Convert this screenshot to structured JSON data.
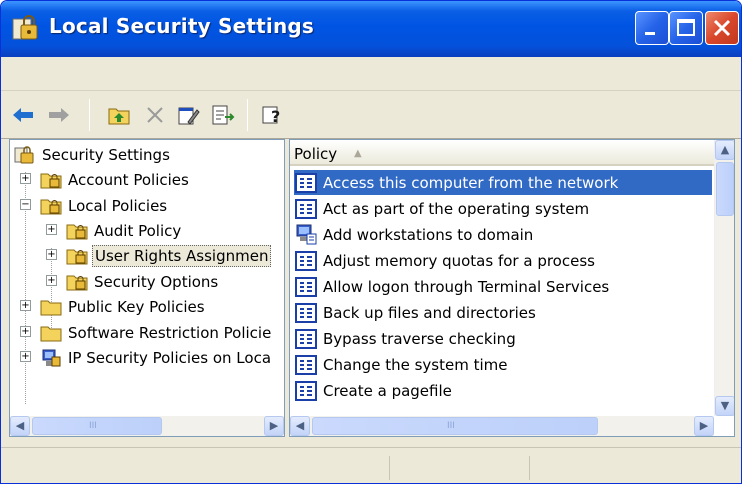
{
  "window": {
    "title": "Local Security Settings",
    "title_icon": "security-settings-icon",
    "controls": [
      "minimize-icon",
      "maximize-icon",
      "close-icon"
    ]
  },
  "toolbar": {
    "buttons": [
      "back-arrow-icon",
      "forward-arrow-icon",
      "up-one-level-icon",
      "delete-icon",
      "properties-icon",
      "export-list-icon",
      "help-icon"
    ]
  },
  "tree": {
    "items": [
      {
        "label": "Security Settings"
      },
      {
        "label": "Account Policies"
      },
      {
        "label": "Local Policies"
      },
      {
        "label": "Audit Policy"
      },
      {
        "label": "User Rights Assignmen"
      },
      {
        "label": "Security Options"
      },
      {
        "label": "Public Key Policies"
      },
      {
        "label": "Software Restriction Policie"
      },
      {
        "label": "IP Security Policies on Loca"
      }
    ],
    "expander_plus": "+",
    "expander_minus": "−"
  },
  "list": {
    "column_header": "Policy",
    "sort_indicator": "▲",
    "rows": [
      "Access this computer from the network",
      "Act as part of the operating system",
      "Add workstations to domain",
      "Adjust memory quotas for a process",
      "Allow logon through Terminal Services",
      "Back up files and directories",
      "Bypass traverse checking",
      "Change the system time",
      "Create a pagefile"
    ]
  },
  "scroll": {
    "up": "▲",
    "down": "▼",
    "left": "◀",
    "right": "▶",
    "grip": "III"
  },
  "colors": {
    "selection": "#316ac5",
    "title_bar": "#0054e3",
    "folder": "#f3d35b"
  }
}
